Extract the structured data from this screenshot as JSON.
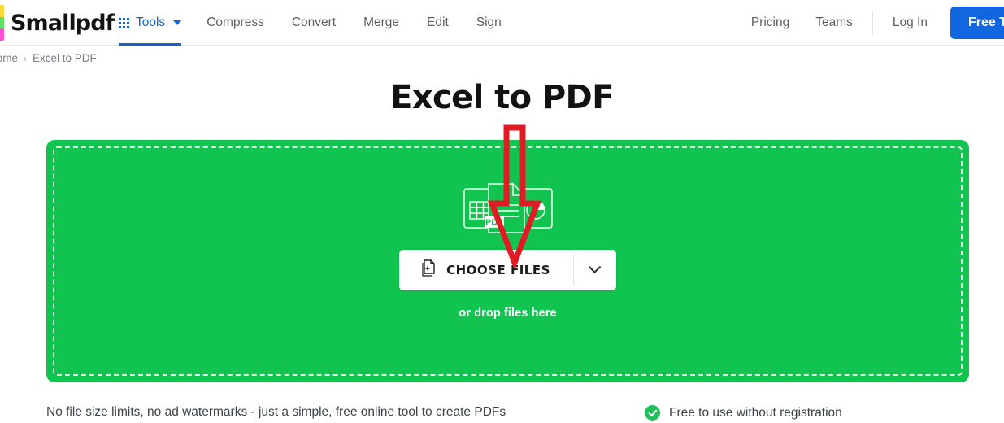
{
  "brand": {
    "name": "Smallpdf",
    "mark_colors": [
      "#ffd93b",
      "#5ee061",
      "#ff4fd0"
    ]
  },
  "header": {
    "tools": {
      "label": "Tools",
      "icon": "grid-icon",
      "caret": "chevron-down-icon"
    },
    "nav_items": [
      {
        "label": "Compress"
      },
      {
        "label": "Convert"
      },
      {
        "label": "Merge"
      },
      {
        "label": "Edit"
      },
      {
        "label": "Sign"
      }
    ],
    "right_items": [
      {
        "label": "Pricing"
      },
      {
        "label": "Teams"
      }
    ],
    "login_label": "Log In",
    "cta_label": "Free T",
    "accent_blue": "#1264d6"
  },
  "breadcrumb": {
    "home": "Home",
    "separator": "›",
    "current": "Excel to PDF"
  },
  "main": {
    "title": "Excel to PDF",
    "dropzone": {
      "background": "#11c44f",
      "choose_files_label": "CHOOSE FILES",
      "drop_hint": "or drop files here",
      "file_icon": "document-add-icon",
      "dropdown_icon": "chevron-down-icon",
      "illustration": "excel-pdf-powerpoint-documents-icon"
    },
    "annotation": {
      "shape": "down-arrow-outline",
      "color": "#e01b24"
    }
  },
  "footer": {
    "tagline": "No file size limits, no ad watermarks - just a simple, free online tool to create PDFs",
    "benefit": "Free to use without registration",
    "benefit_icon": "check-circle-icon",
    "benefit_color": "#21c05a"
  }
}
